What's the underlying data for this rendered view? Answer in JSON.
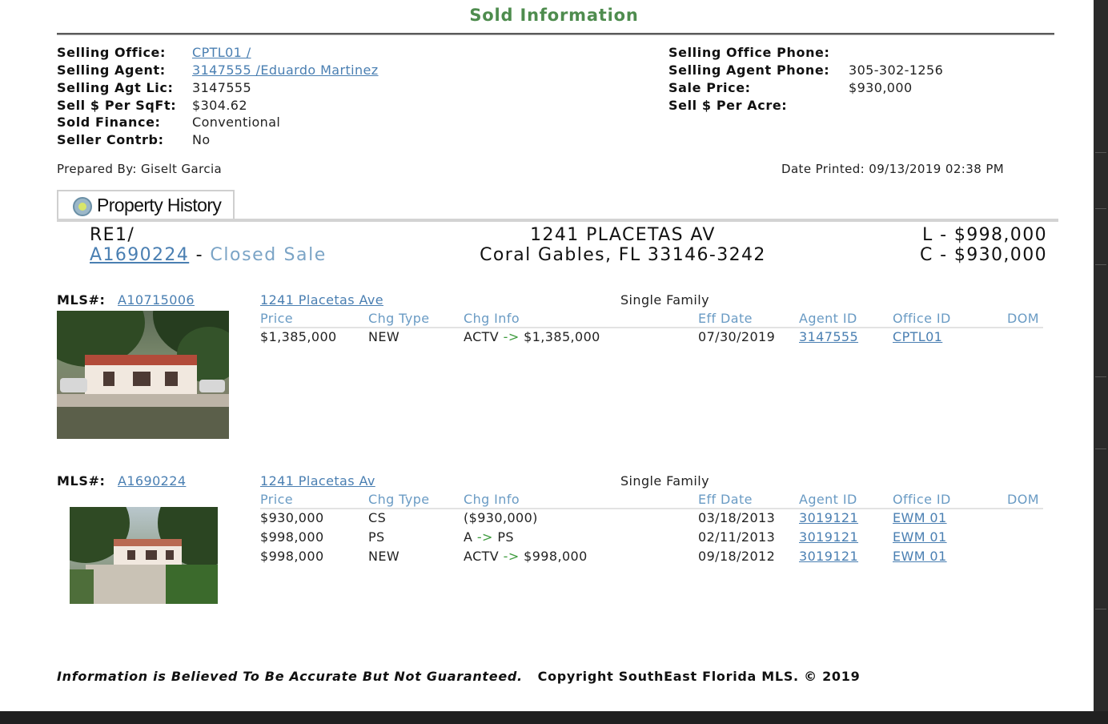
{
  "title": "Sold Information",
  "sold": {
    "selling_office_label": "Selling Office:",
    "selling_office_value": "CPTL01 /",
    "selling_agent_label": "Selling Agent:",
    "selling_agent_value": "3147555 /Eduardo Martinez",
    "selling_agt_lic_label": "Selling Agt Lic:",
    "selling_agt_lic_value": "3147555",
    "sell_per_sqft_label": "Sell $ Per SqFt:",
    "sell_per_sqft_value": "$304.62",
    "sold_finance_label": "Sold Finance:",
    "sold_finance_value": "Conventional",
    "seller_contrb_label": "Seller Contrb:",
    "seller_contrb_value": "No",
    "selling_office_phone_label": "Selling Office Phone:",
    "selling_agent_phone_label": "Selling Agent Phone:",
    "selling_agent_phone_value": "305-302-1256",
    "sale_price_label": "Sale Price:",
    "sale_price_value": "$930,000",
    "sell_per_acre_label": "Sell $ Per Acre:"
  },
  "prepared_by": "Prepared By: Giselt Garcia",
  "date_printed": "Date Printed: 09/13/2019 02:38 PM",
  "history": {
    "tab_label": "Property History",
    "re_code": "RE1/",
    "mls_link": "A1690224",
    "dash": " - ",
    "status": "Closed Sale",
    "address_line1": "1241 PLACETAS AV",
    "address_line2": "Coral Gables, FL 33146-3242",
    "list_price": "L - $998,000",
    "close_price": "C - $930,000"
  },
  "columns": {
    "price": "Price",
    "chg_type": "Chg Type",
    "chg_info": "Chg Info",
    "eff_date": "Eff Date",
    "agent_id": "Agent ID",
    "office_id": "Office ID",
    "dom": "DOM"
  },
  "listings": [
    {
      "mls_label": "MLS#:",
      "mls_number": "A10715006",
      "address": "1241 Placetas Ave",
      "property_type": "Single Family",
      "rows": [
        {
          "price": "$1,385,000",
          "chg_type": "NEW",
          "chg_info_pre": "ACTV",
          "chg_info_arrow": "->",
          "chg_info_post": "$1,385,000",
          "eff_date": "07/30/2019",
          "agent_id": "3147555",
          "office_id": "CPTL01"
        }
      ]
    },
    {
      "mls_label": "MLS#:",
      "mls_number": "A1690224",
      "address": "1241 Placetas Av",
      "property_type": "Single Family",
      "rows": [
        {
          "price": "$930,000",
          "chg_type": "CS",
          "chg_info_pre": "($930,000)",
          "chg_info_arrow": "",
          "chg_info_post": "",
          "eff_date": "03/18/2013",
          "agent_id": "3019121",
          "office_id": "EWM 01"
        },
        {
          "price": "$998,000",
          "chg_type": "PS",
          "chg_info_pre": "A",
          "chg_info_arrow": "->",
          "chg_info_post": "PS",
          "eff_date": "02/11/2013",
          "agent_id": "3019121",
          "office_id": "EWM 01"
        },
        {
          "price": "$998,000",
          "chg_type": "NEW",
          "chg_info_pre": "ACTV",
          "chg_info_arrow": "->",
          "chg_info_post": "$998,000",
          "eff_date": "09/18/2012",
          "agent_id": "3019121",
          "office_id": "EWM 01"
        }
      ]
    }
  ],
  "footer": {
    "disclaimer": "Information is Believed To Be Accurate But Not Guaranteed.",
    "copyright": "Copyright SouthEast Florida MLS. © 2019"
  },
  "colors": {
    "title_green": "#4e8c4e",
    "link_blue": "#4a7fb2",
    "header_blue": "#6a9bc4",
    "arrow_green": "#3f9c3f"
  },
  "icons": [
    "history-icon"
  ]
}
